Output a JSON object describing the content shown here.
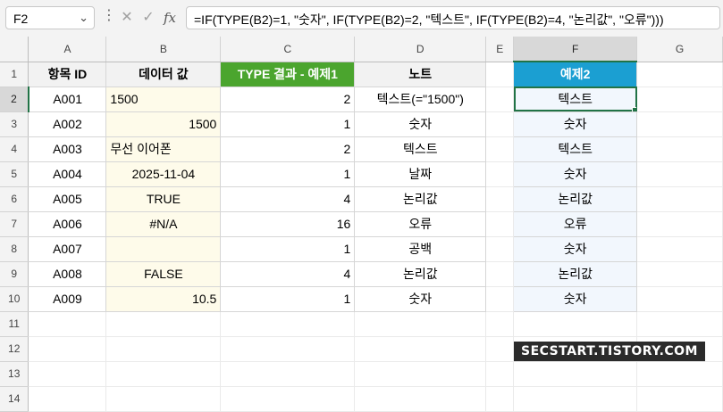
{
  "formula_bar": {
    "name_box": "F2",
    "name_box_dropdown": "⌄",
    "more_icon": "⋮",
    "cancel_icon": "✕",
    "enter_icon": "✓",
    "fx_label": "fx",
    "formula": "=IF(TYPE(B2)=1, \"숫자\", IF(TYPE(B2)=2, \"텍스트\", IF(TYPE(B2)=4, \"논리값\", \"오류\")))"
  },
  "columns": [
    "A",
    "B",
    "C",
    "D",
    "E",
    "F",
    "G"
  ],
  "selected_cell": "F2",
  "headers": {
    "a": "항목 ID",
    "b": "데이터 값",
    "c": "TYPE 결과 - 예제1",
    "d": "노트",
    "f": "예제2"
  },
  "rows": [
    {
      "n": "1"
    },
    {
      "n": "2",
      "a": "A001",
      "b": "1500",
      "c": "2",
      "d": "텍스트(=\"1500\")",
      "f": "텍스트"
    },
    {
      "n": "3",
      "a": "A002",
      "b": "1500",
      "c": "1",
      "d": "숫자",
      "f": "숫자"
    },
    {
      "n": "4",
      "a": "A003",
      "b": "무선 이어폰",
      "c": "2",
      "d": "텍스트",
      "f": "텍스트"
    },
    {
      "n": "5",
      "a": "A004",
      "b": "2025-11-04",
      "c": "1",
      "d": "날짜",
      "f": "숫자"
    },
    {
      "n": "6",
      "a": "A005",
      "b": "TRUE",
      "c": "4",
      "d": "논리값",
      "f": "논리값"
    },
    {
      "n": "7",
      "a": "A006",
      "b": "#N/A",
      "c": "16",
      "d": "오류",
      "f": "오류"
    },
    {
      "n": "8",
      "a": "A007",
      "b": "",
      "c": "1",
      "d": "공백",
      "f": "숫자"
    },
    {
      "n": "9",
      "a": "A008",
      "b": "FALSE",
      "c": "4",
      "d": "논리값",
      "f": "논리값"
    },
    {
      "n": "10",
      "a": "A009",
      "b": "10.5",
      "c": "1",
      "d": "숫자",
      "f": "숫자"
    },
    {
      "n": "11"
    },
    {
      "n": "12"
    },
    {
      "n": "13"
    },
    {
      "n": "14"
    }
  ],
  "watermark": "SECSTART.TISTORY.COM",
  "colors": {
    "accent": "#217346",
    "header_green": "#4ba52e",
    "header_blue": "#1b9fd2",
    "input_fill": "#fefbea",
    "output_fill": "#f2f7fd"
  }
}
